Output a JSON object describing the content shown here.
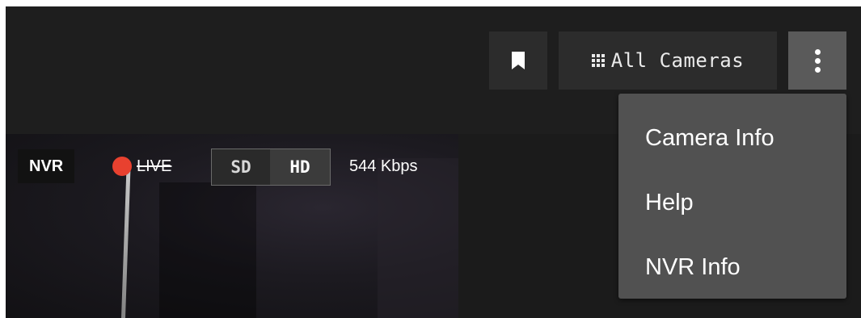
{
  "toolbar": {
    "cameras_label": "All Cameras"
  },
  "video": {
    "nvr_label": "NVR",
    "live_label": "LIVE",
    "quality": {
      "sd": "SD",
      "hd": "HD",
      "selected": "HD"
    },
    "bitrate": "544 Kbps"
  },
  "menu": {
    "items": [
      {
        "label": "Camera Info"
      },
      {
        "label": "Help"
      },
      {
        "label": "NVR Info"
      }
    ]
  },
  "colors": {
    "background": "#1b1b1b",
    "live_dot": "#e8412f",
    "menu_bg": "#515151"
  }
}
